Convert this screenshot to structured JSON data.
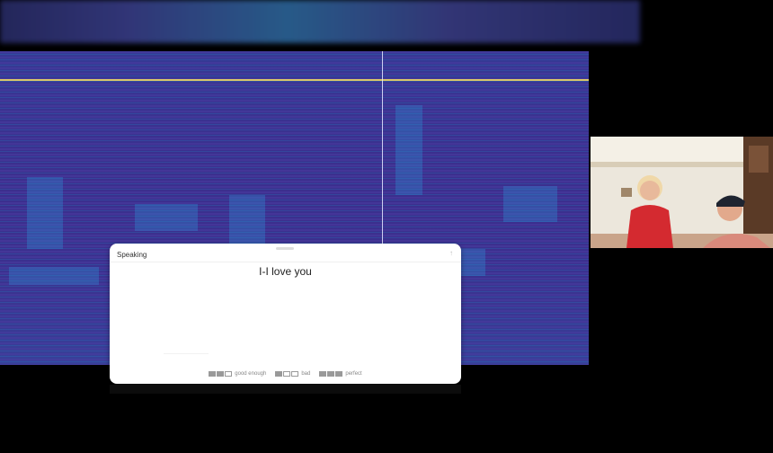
{
  "panel": {
    "title": "Speaking",
    "transcript": "I-I love you",
    "ratings": [
      {
        "label": "good enough",
        "level": 2
      },
      {
        "label": "bad",
        "level": 1
      },
      {
        "label": "perfect",
        "level": 3
      }
    ]
  },
  "colors": {
    "spectrogram_base": "#3b2f8e",
    "spectrogram_highlight": "#2f8fd4",
    "marker_line": "#d9c76a"
  }
}
